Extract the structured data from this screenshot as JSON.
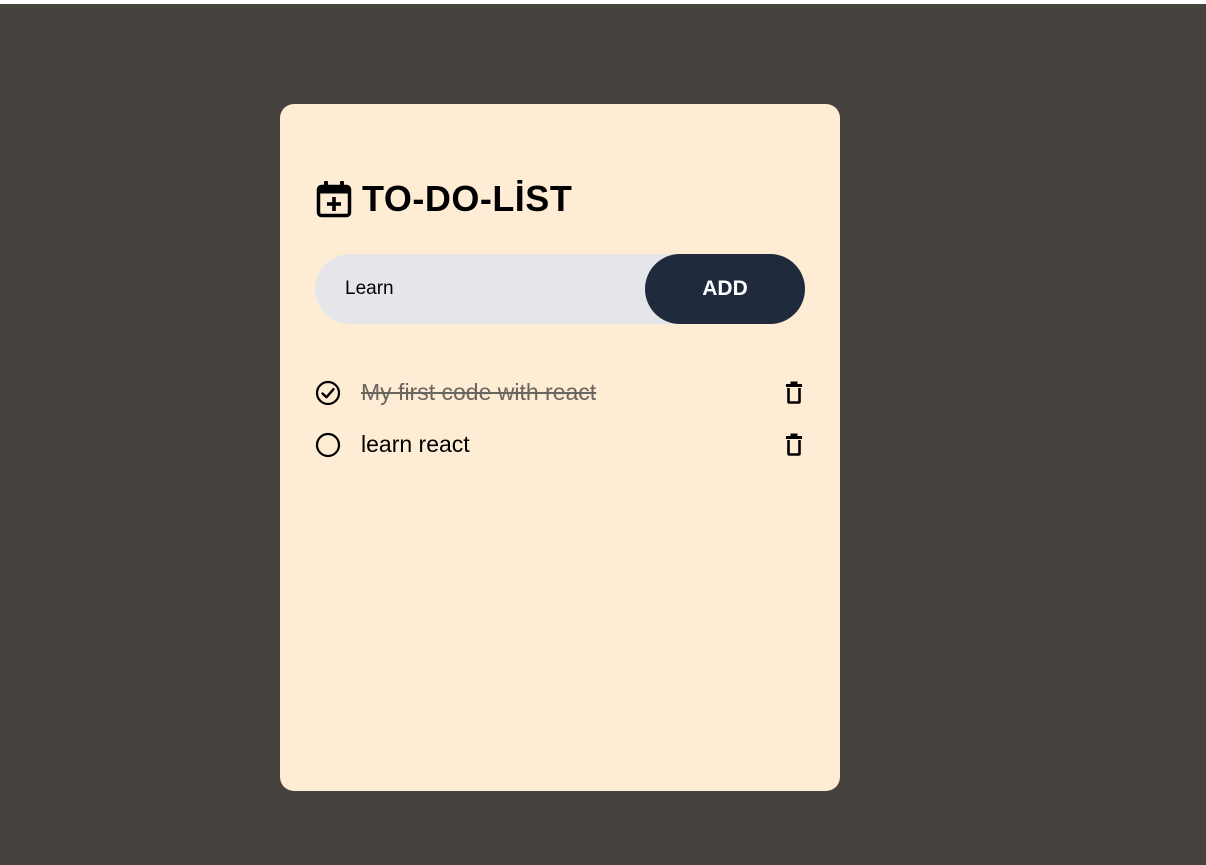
{
  "app": {
    "title": "TO-DO-LİST",
    "header_icon": "calendar-plus-icon"
  },
  "form": {
    "input_value": "Learn",
    "add_label": "ADD"
  },
  "todos": [
    {
      "text": "My first code with react",
      "completed": true
    },
    {
      "text": "learn react",
      "completed": false
    }
  ],
  "colors": {
    "background": "#46423d",
    "card": "#ffecd4",
    "input": "#e6e6ea",
    "button": "#1f2a3c",
    "completed_text": "#6b6560"
  }
}
